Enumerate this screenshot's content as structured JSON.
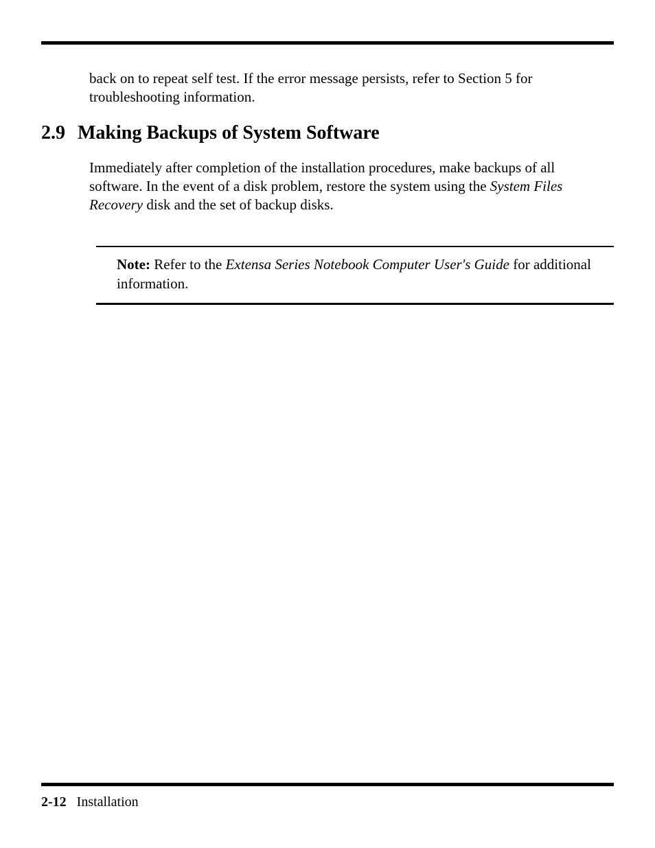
{
  "continuation_paragraph": "back on to repeat self test. If the error message persists, refer to Section 5 for troubleshooting information.",
  "section": {
    "number": "2.9",
    "title": "Making Backups of System Software",
    "body_part1": "Immediately after completion of the installation procedures, make backups of all software. In the event of a disk problem, restore the system using the ",
    "body_italic1": "System Files Recovery",
    "body_part2": " disk and the set of backup disks."
  },
  "note": {
    "label": "Note:",
    "part1": "  Refer to the ",
    "italic": "Extensa  Series Notebook Computer User's Guide",
    "part2": " for additional information."
  },
  "footer": {
    "page_number": "2-12",
    "section_name": "Installation"
  }
}
